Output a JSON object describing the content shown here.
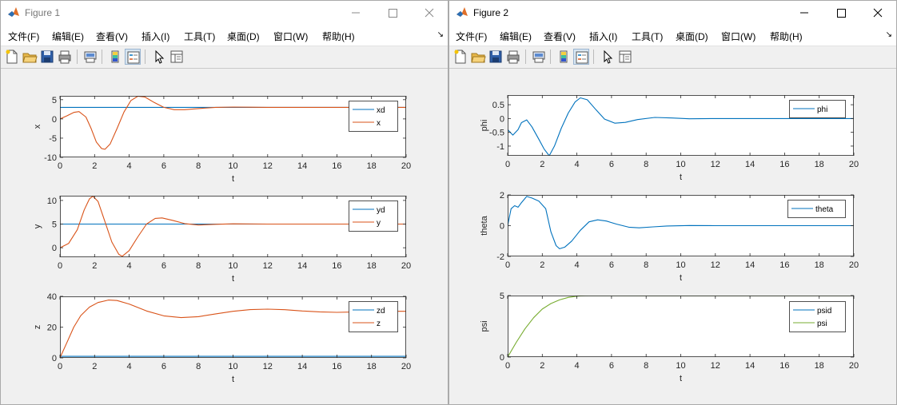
{
  "figures": [
    {
      "title": "Figure 1",
      "active": false,
      "menu": [
        "文件(F)",
        "编辑(E)",
        "查看(V)",
        "插入(I)",
        "工具(T)",
        "桌面(D)",
        "窗口(W)",
        "帮助(H)"
      ],
      "toolbar": [
        "new-file",
        "open-folder",
        "save",
        "print",
        "print-preview",
        "colorbar",
        "legend",
        "pointer-select",
        "property-inspector"
      ],
      "axes": [
        {
          "ylabel": "x",
          "xlabel": "t",
          "xlim": [
            0,
            20
          ],
          "ylim": [
            -10,
            6
          ],
          "xticks": [
            0,
            2,
            4,
            6,
            8,
            10,
            12,
            14,
            16,
            18,
            20
          ],
          "yticks": [
            -10,
            -5,
            0,
            5
          ],
          "series": [
            {
              "name": "xd",
              "color": "#0072BD",
              "points": [
                [
                  0,
                  3
                ],
                [
                  20,
                  3
                ]
              ]
            },
            {
              "name": "x",
              "color": "#D95319",
              "points": [
                [
                  0,
                  0
                ],
                [
                  0.4,
                  0.8
                ],
                [
                  0.8,
                  1.7
                ],
                [
                  1.1,
                  1.9
                ],
                [
                  1.5,
                  0.5
                ],
                [
                  1.8,
                  -2.5
                ],
                [
                  2.1,
                  -6
                ],
                [
                  2.4,
                  -7.7
                ],
                [
                  2.6,
                  -7.9
                ],
                [
                  2.9,
                  -6.5
                ],
                [
                  3.3,
                  -2.5
                ],
                [
                  3.7,
                  1.8
                ],
                [
                  4.1,
                  4.8
                ],
                [
                  4.5,
                  5.9
                ],
                [
                  4.9,
                  5.7
                ],
                [
                  5.4,
                  4.4
                ],
                [
                  6,
                  3.0
                ],
                [
                  6.6,
                  2.4
                ],
                [
                  7.2,
                  2.4
                ],
                [
                  8,
                  2.7
                ],
                [
                  9,
                  3.0
                ],
                [
                  10,
                  3.1
                ],
                [
                  11,
                  3.05
                ],
                [
                  12,
                  3.0
                ],
                [
                  14,
                  3.0
                ],
                [
                  20,
                  3.0
                ]
              ]
            }
          ]
        },
        {
          "ylabel": "y",
          "xlabel": "t",
          "xlim": [
            0,
            20
          ],
          "ylim": [
            -2,
            11
          ],
          "xticks": [
            0,
            2,
            4,
            6,
            8,
            10,
            12,
            14,
            16,
            18,
            20
          ],
          "yticks": [
            0,
            5,
            10
          ],
          "series": [
            {
              "name": "yd",
              "color": "#0072BD",
              "points": [
                [
                  0,
                  5
                ],
                [
                  20,
                  5
                ]
              ]
            },
            {
              "name": "y",
              "color": "#D95319",
              "points": [
                [
                  0,
                  0
                ],
                [
                  0.5,
                  0.9
                ],
                [
                  1,
                  3.8
                ],
                [
                  1.4,
                  8
                ],
                [
                  1.7,
                  10.3
                ],
                [
                  1.9,
                  10.9
                ],
                [
                  2.2,
                  9.8
                ],
                [
                  2.6,
                  5.5
                ],
                [
                  3,
                  1.2
                ],
                [
                  3.4,
                  -1.4
                ],
                [
                  3.6,
                  -1.8
                ],
                [
                  4,
                  -0.6
                ],
                [
                  4.5,
                  2.3
                ],
                [
                  5,
                  5
                ],
                [
                  5.5,
                  6.2
                ],
                [
                  5.9,
                  6.3
                ],
                [
                  6.5,
                  5.8
                ],
                [
                  7.2,
                  5.1
                ],
                [
                  8,
                  4.8
                ],
                [
                  9,
                  4.95
                ],
                [
                  10,
                  5.05
                ],
                [
                  12,
                  5.0
                ],
                [
                  20,
                  5.0
                ]
              ]
            }
          ]
        },
        {
          "ylabel": "z",
          "xlabel": "t",
          "xlim": [
            0,
            20
          ],
          "ylim": [
            0,
            40
          ],
          "xticks": [
            0,
            2,
            4,
            6,
            8,
            10,
            12,
            14,
            16,
            18,
            20
          ],
          "yticks": [
            0,
            20,
            40
          ],
          "series": [
            {
              "name": "zd",
              "color": "#0072BD",
              "points": [
                [
                  0,
                  1
                ],
                [
                  20,
                  1
                ]
              ]
            },
            {
              "name": "z",
              "color": "#D95319",
              "points": [
                [
                  0,
                  0
                ],
                [
                  0.4,
                  10
                ],
                [
                  0.8,
                  20
                ],
                [
                  1.2,
                  27.5
                ],
                [
                  1.7,
                  33
                ],
                [
                  2.2,
                  36
                ],
                [
                  2.8,
                  37.6
                ],
                [
                  3.3,
                  37.3
                ],
                [
                  4,
                  35
                ],
                [
                  5,
                  30.5
                ],
                [
                  6,
                  27.3
                ],
                [
                  7,
                  26.2
                ],
                [
                  8,
                  26.8
                ],
                [
                  9,
                  28.6
                ],
                [
                  10,
                  30.3
                ],
                [
                  11,
                  31.4
                ],
                [
                  12,
                  31.7
                ],
                [
                  13,
                  31.3
                ],
                [
                  14,
                  30.5
                ],
                [
                  15,
                  29.9
                ],
                [
                  16,
                  29.6
                ],
                [
                  17,
                  29.8
                ],
                [
                  18,
                  30.1
                ],
                [
                  19,
                  30.3
                ],
                [
                  20,
                  30.3
                ]
              ]
            }
          ]
        }
      ]
    },
    {
      "title": "Figure 2",
      "active": true,
      "menu": [
        "文件(F)",
        "编辑(E)",
        "查看(V)",
        "插入(I)",
        "工具(T)",
        "桌面(D)",
        "窗口(W)",
        "帮助(H)"
      ],
      "toolbar": [
        "new-file",
        "open-folder",
        "save",
        "print",
        "print-preview",
        "colorbar",
        "legend",
        "pointer-select",
        "property-inspector"
      ],
      "axes": [
        {
          "ylabel": "phi",
          "xlabel": "t",
          "xlim": [
            0,
            20
          ],
          "ylim": [
            -1.35,
            0.85
          ],
          "xticks": [
            0,
            2,
            4,
            6,
            8,
            10,
            12,
            14,
            16,
            18,
            20
          ],
          "yticks": [
            -1,
            -0.5,
            0,
            0.5
          ],
          "series": [
            {
              "name": "phi",
              "color": "#0072BD",
              "points": [
                [
                  0,
                  -0.4
                ],
                [
                  0.3,
                  -0.6
                ],
                [
                  0.6,
                  -0.4
                ],
                [
                  0.8,
                  -0.15
                ],
                [
                  1.1,
                  -0.05
                ],
                [
                  1.4,
                  -0.3
                ],
                [
                  1.8,
                  -0.75
                ],
                [
                  2.1,
                  -1.1
                ],
                [
                  2.4,
                  -1.35
                ],
                [
                  2.7,
                  -1.0
                ],
                [
                  3.1,
                  -0.35
                ],
                [
                  3.5,
                  0.2
                ],
                [
                  3.9,
                  0.6
                ],
                [
                  4.2,
                  0.75
                ],
                [
                  4.6,
                  0.68
                ],
                [
                  5.1,
                  0.32
                ],
                [
                  5.6,
                  -0.02
                ],
                [
                  6.2,
                  -0.17
                ],
                [
                  6.8,
                  -0.14
                ],
                [
                  7.5,
                  -0.04
                ],
                [
                  8.5,
                  0.04
                ],
                [
                  9.5,
                  0.02
                ],
                [
                  10.5,
                  -0.01
                ],
                [
                  12,
                  0
                ],
                [
                  20,
                  0
                ]
              ]
            }
          ]
        },
        {
          "ylabel": "theta",
          "xlabel": "t",
          "xlim": [
            0,
            20
          ],
          "ylim": [
            -2,
            2
          ],
          "xticks": [
            0,
            2,
            4,
            6,
            8,
            10,
            12,
            14,
            16,
            18,
            20
          ],
          "yticks": [
            -2,
            0,
            2
          ],
          "series": [
            {
              "name": "theta",
              "color": "#0072BD",
              "points": [
                [
                  0,
                  0
                ],
                [
                  0.2,
                  1.1
                ],
                [
                  0.4,
                  1.3
                ],
                [
                  0.6,
                  1.2
                ],
                [
                  0.8,
                  1.5
                ],
                [
                  1.1,
                  1.9
                ],
                [
                  1.4,
                  1.8
                ],
                [
                  1.8,
                  1.6
                ],
                [
                  2.2,
                  1.1
                ],
                [
                  2.5,
                  -0.4
                ],
                [
                  2.8,
                  -1.3
                ],
                [
                  3.0,
                  -1.5
                ],
                [
                  3.3,
                  -1.4
                ],
                [
                  3.7,
                  -1.0
                ],
                [
                  4.2,
                  -0.3
                ],
                [
                  4.7,
                  0.25
                ],
                [
                  5.2,
                  0.38
                ],
                [
                  5.7,
                  0.3
                ],
                [
                  6.3,
                  0.1
                ],
                [
                  7,
                  -0.1
                ],
                [
                  7.6,
                  -0.14
                ],
                [
                  8.4,
                  -0.08
                ],
                [
                  9.2,
                  -0.02
                ],
                [
                  10.5,
                  0.01
                ],
                [
                  12,
                  0
                ],
                [
                  20,
                  0
                ]
              ]
            }
          ]
        },
        {
          "ylabel": "psi",
          "xlabel": "t",
          "xlim": [
            0,
            20
          ],
          "ylim": [
            0,
            5
          ],
          "xticks": [
            0,
            2,
            4,
            6,
            8,
            10,
            12,
            14,
            16,
            18,
            20
          ],
          "yticks": [
            0,
            5
          ],
          "series": [
            {
              "name": "psid",
              "color": "#0072BD",
              "points": []
            },
            {
              "name": "psi",
              "color": "#77AC30",
              "points": [
                [
                  0,
                  0
                ],
                [
                  0.5,
                  1.2
                ],
                [
                  1,
                  2.3
                ],
                [
                  1.5,
                  3.2
                ],
                [
                  2,
                  3.9
                ],
                [
                  2.5,
                  4.35
                ],
                [
                  3,
                  4.65
                ],
                [
                  3.5,
                  4.85
                ],
                [
                  4,
                  4.95
                ],
                [
                  4.5,
                  5.0
                ],
                [
                  5,
                  5.02
                ],
                [
                  6,
                  5.01
                ],
                [
                  8,
                  5.0
                ],
                [
                  20,
                  5.0
                ]
              ]
            }
          ]
        }
      ]
    }
  ]
}
